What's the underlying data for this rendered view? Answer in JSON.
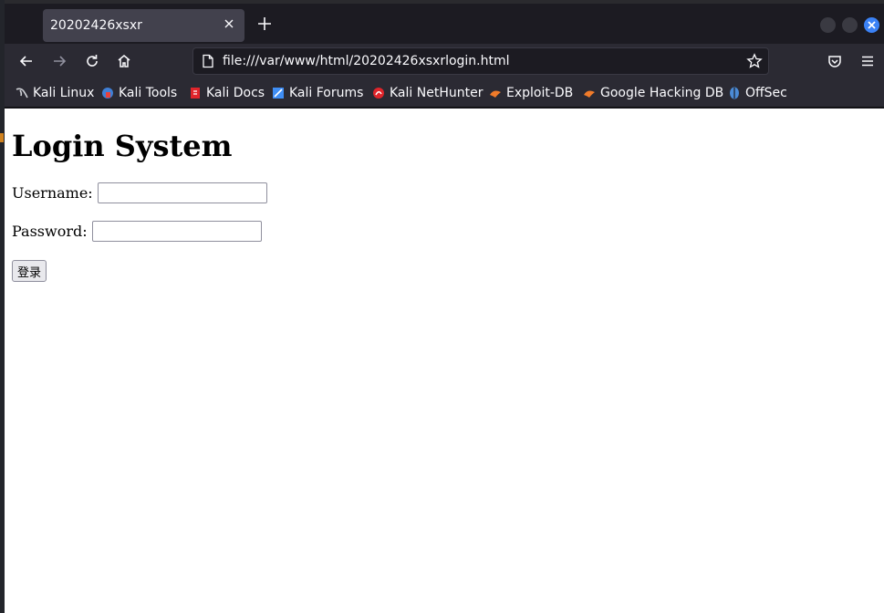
{
  "browser": {
    "tab": {
      "title": "20202426xsxr"
    },
    "url": "file:///var/www/html/20202426xsxrlogin.html",
    "bookmarks": [
      {
        "label": "Kali Linux",
        "icon": "kali-dragon-icon",
        "color": "#9aa0a6"
      },
      {
        "label": "Kali Tools",
        "icon": "kali-tools-icon",
        "color": "#e8413c"
      },
      {
        "label": "Kali Docs",
        "icon": "kali-docs-icon",
        "color": "#e0252b"
      },
      {
        "label": "Kali Forums",
        "icon": "kali-forums-icon",
        "color": "#3f8ef5"
      },
      {
        "label": "Kali NetHunter",
        "icon": "kali-nethunter-icon",
        "color": "#e0252b"
      },
      {
        "label": "Exploit-DB",
        "icon": "exploit-db-icon",
        "color": "#f07b2a"
      },
      {
        "label": "Google Hacking DB",
        "icon": "google-hacking-db-icon",
        "color": "#f07b2a"
      },
      {
        "label": "OffSec",
        "icon": "offsec-icon",
        "color": "#4b8bd6"
      }
    ]
  },
  "page": {
    "heading": "Login System",
    "username_label": "Username:",
    "username_value": "",
    "password_label": "Password:",
    "password_value": "",
    "submit_label": "登录"
  },
  "colors": {
    "chrome_dark": "#1c1b22",
    "toolbar": "#2b2a33",
    "tab_active": "#42414d",
    "close_button": "#3b82f6"
  }
}
